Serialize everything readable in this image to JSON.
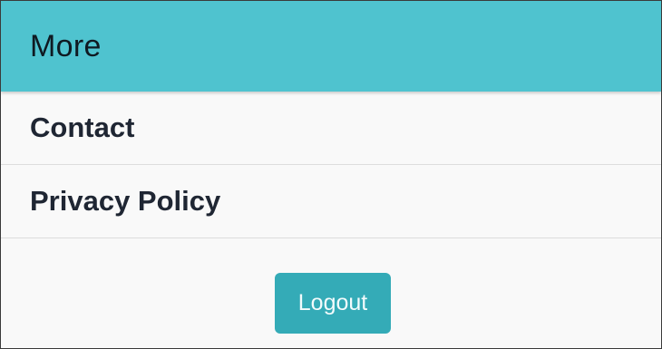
{
  "header": {
    "title": "More",
    "color": "#4fc3cf"
  },
  "menu": {
    "items": [
      {
        "label": "Contact"
      },
      {
        "label": "Privacy Policy"
      }
    ]
  },
  "footer": {
    "logout_label": "Logout",
    "button_color": "#34abb7"
  }
}
